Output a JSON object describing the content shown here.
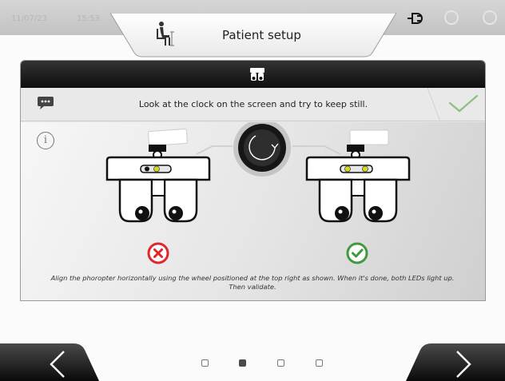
{
  "status_bar": {
    "date": "11/07/23",
    "time": "15:53"
  },
  "header": {
    "title": "Patient setup",
    "title_icon": "patient-seated-icon",
    "status_icons": [
      "plug-icon",
      "timer-icon",
      "settings-icon"
    ]
  },
  "panel": {
    "header_icon": "phoropter-icon",
    "instruction": "Look at the clock on the screen and try to keep still.",
    "instruction_icon": "chat-icon",
    "validate_icon": "checkmark-icon",
    "info_icon": "info-icon",
    "caption": "Align the phoropter horizontally using the wheel positioned at the top right as shown. When it's done, both LEDs light up. Then validate.",
    "examples": [
      {
        "state": "incorrect",
        "icon": "cross-icon",
        "color": "#e0262b"
      },
      {
        "state": "correct",
        "icon": "check-icon",
        "color": "#3f9a3c"
      }
    ],
    "wheel_icon": "rotate-wheel-icon"
  },
  "navigation": {
    "previous_icon": "chevron-left-icon",
    "next_icon": "chevron-right-icon",
    "pages": 4,
    "current_page": 2
  },
  "colors": {
    "accent_green": "#3f9a3c",
    "error_red": "#e0262b",
    "led_yellow": "#d8d820",
    "header_dark": "#111111"
  }
}
